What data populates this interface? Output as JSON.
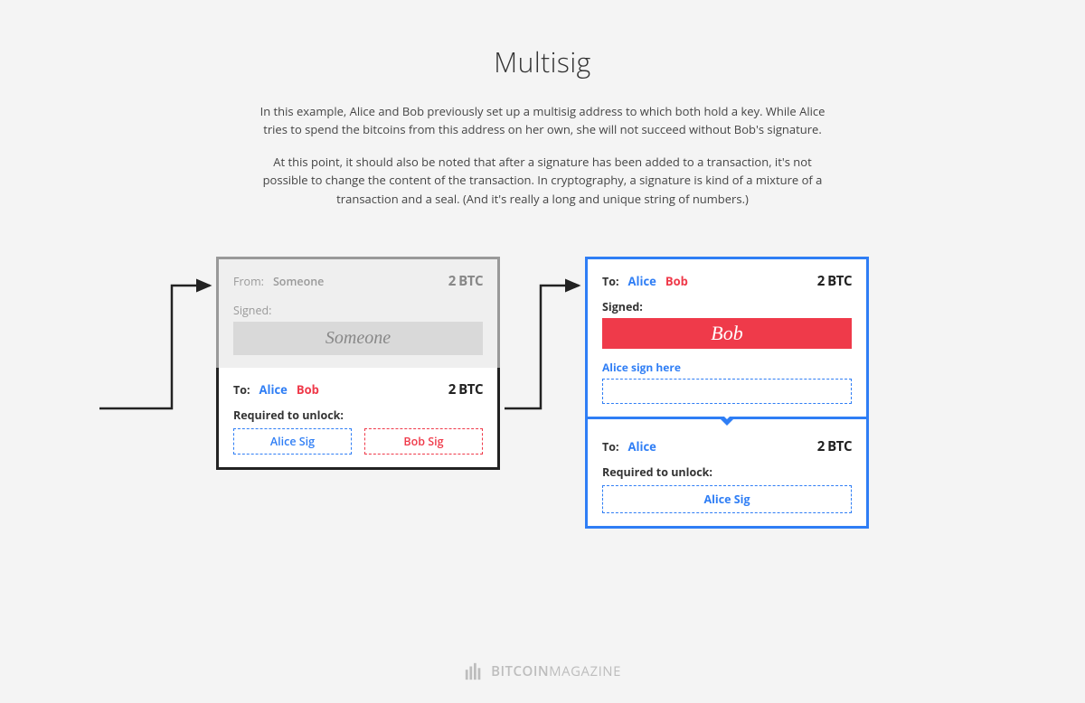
{
  "title": "Multisig",
  "paragraph1": "In this example, Alice and Bob previously set up a multisig address to which both hold a key. While Alice tries to spend the bitcoins from this address on her own, she will not succeed without Bob's signature.",
  "paragraph2": "At this point, it should also be noted that after a signature has been added to a transaction, it's not possible to change the content of the transaction. In cryptography, a signature is kind of a mixture of a transaction and a seal. (And it's really a long and unique string of numbers.)",
  "left": {
    "top": {
      "from_label": "From:",
      "from_value": "Someone",
      "amount": "2 BTC",
      "signed_label": "Signed:",
      "signature": "Someone"
    },
    "bottom": {
      "to_label": "To:",
      "to_alice": "Alice",
      "to_bob": "Bob",
      "amount": "2 BTC",
      "required_label": "Required to unlock:",
      "alice_sig": "Alice Sig",
      "bob_sig": "Bob Sig"
    }
  },
  "right": {
    "top": {
      "to_label": "To:",
      "to_alice": "Alice",
      "to_bob": "Bob",
      "amount": "2 BTC",
      "signed_label": "Signed:",
      "bob_signature": "Bob",
      "alice_sign_here": "Alice sign here"
    },
    "bottom": {
      "to_label": "To:",
      "to_alice": "Alice",
      "amount": "2 BTC",
      "required_label": "Required to unlock:",
      "alice_sig": "Alice Sig"
    }
  },
  "footer": {
    "brand_bold": "BITCOIN",
    "brand_light": "MAGAZINE"
  }
}
